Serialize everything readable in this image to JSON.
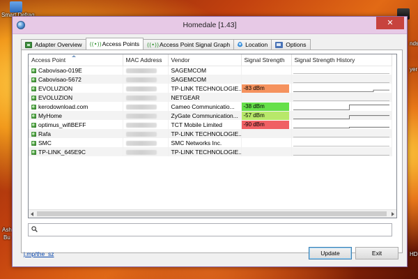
{
  "desktop": {
    "icons": [
      {
        "label": "Smart Defrag"
      },
      {
        "label": "Ash"
      },
      {
        "label": "Bu"
      },
      {
        "label": "nds"
      },
      {
        "label": "yer"
      },
      {
        "label": "HD"
      }
    ]
  },
  "window": {
    "title": "Homedale [1.43]",
    "close_glyph": "✕"
  },
  "tabs": [
    {
      "label": "Adapter Overview",
      "icon": "adapter-icon",
      "active": false
    },
    {
      "label": "Access Points",
      "icon": "wifi-signal-icon",
      "active": true
    },
    {
      "label": "Access Point Signal Graph",
      "icon": "wifi-signal-icon",
      "active": false
    },
    {
      "label": "Location",
      "icon": "location-pin-icon",
      "active": false
    },
    {
      "label": "Options",
      "icon": "options-icon",
      "active": false
    }
  ],
  "table": {
    "columns": [
      "Access Point",
      "MAC Address",
      "Vendor",
      "Signal Strength",
      "Signal Strength History"
    ],
    "rows": [
      {
        "ap": "Cabovisao-019E",
        "mac": "C0-AC-54-F5-01-9E",
        "vendor": "SAGEMCOM",
        "signal": "",
        "history": [
          0,
          0,
          0,
          0,
          0,
          0,
          0,
          0,
          0,
          0,
          0,
          0
        ],
        "active": false
      },
      {
        "ap": "Cabovisao-5672",
        "mac": "C0-AC-54-F5-56-72",
        "vendor": "SAGEMCOM",
        "signal": "",
        "history": [
          0,
          0,
          0,
          0,
          0,
          0,
          0,
          0,
          0,
          0,
          0,
          0
        ],
        "active": false
      },
      {
        "ap": "EVOLUZION",
        "mac": "F8-D1-11-AB-3C-20",
        "vendor": "TP-LINK TECHNOLOGIE...",
        "signal": "-83 dBm",
        "history": [
          0,
          0,
          0,
          0,
          0,
          0,
          0,
          0,
          0,
          0,
          0.3,
          0.3
        ],
        "active": true
      },
      {
        "ap": "EVOLUZION",
        "mac": "A0-21-B7-F0-11-42",
        "vendor": "NETGEAR",
        "signal": "",
        "history": [
          0,
          0,
          0,
          0,
          0,
          0,
          0,
          0,
          0,
          0,
          0,
          0
        ],
        "active": false
      },
      {
        "ap": "kerodownload.com",
        "mac": "00-19-C7-5A-12-B0",
        "vendor": "Cameo Communicatio...",
        "signal": "-38 dBm",
        "history": [
          0,
          0,
          0,
          0,
          0,
          0,
          0,
          0.9,
          0.9,
          0.9,
          0.9,
          0.9
        ],
        "active": true
      },
      {
        "ap": "MyHome",
        "mac": "00-02-CF-A1-33-7E",
        "vendor": "ZyGate Communication...",
        "signal": "-57 dBm",
        "history": [
          0,
          0,
          0,
          0,
          0,
          0,
          0,
          0.6,
          0.6,
          0.6,
          0.6,
          0.6
        ],
        "active": true
      },
      {
        "ap": "optimus_wifiBEFF",
        "mac": "00-11-2E-4B-BE-FF",
        "vendor": "TCT Mobile Limited",
        "signal": "-90 dBm",
        "history": [
          0,
          0,
          0,
          0,
          0,
          0,
          0,
          0.15,
          0.15,
          0.15,
          0.15,
          0.15
        ],
        "active": true
      },
      {
        "ap": "Rafa",
        "mac": "B0-48-7A-C1-2D-55",
        "vendor": "TP-LINK TECHNOLOGIE...",
        "signal": "",
        "history": [
          0,
          0,
          0,
          0,
          0,
          0,
          0,
          0,
          0,
          0,
          0,
          0
        ],
        "active": false
      },
      {
        "ap": "SMC",
        "mac": "00-13-F7-4A-9C-01",
        "vendor": "SMC Networks Inc.",
        "signal": "",
        "history": [
          0,
          0,
          0,
          0,
          0,
          0,
          0,
          0,
          0,
          0,
          0,
          0
        ],
        "active": false
      },
      {
        "ap": "TP-LINK_645E9C",
        "mac": "F4-EC-38-64-5E-9C",
        "vendor": "TP-LINK TECHNOLOGIE...",
        "signal": "",
        "history": [
          0,
          0,
          0,
          0,
          0,
          0,
          0,
          0,
          0,
          0,
          0,
          0
        ],
        "active": false
      }
    ]
  },
  "signal_colors": {
    "-83 dBm": "#f5925e",
    "-38 dBm": "#66e04a",
    "-57 dBm": "#b8e86a",
    "-90 dBm": "#f06064"
  },
  "search": {
    "value": "",
    "placeholder": ""
  },
  "footer": {
    "link": "j.mp/the_sz",
    "update_label": "Update",
    "exit_label": "Exit"
  }
}
